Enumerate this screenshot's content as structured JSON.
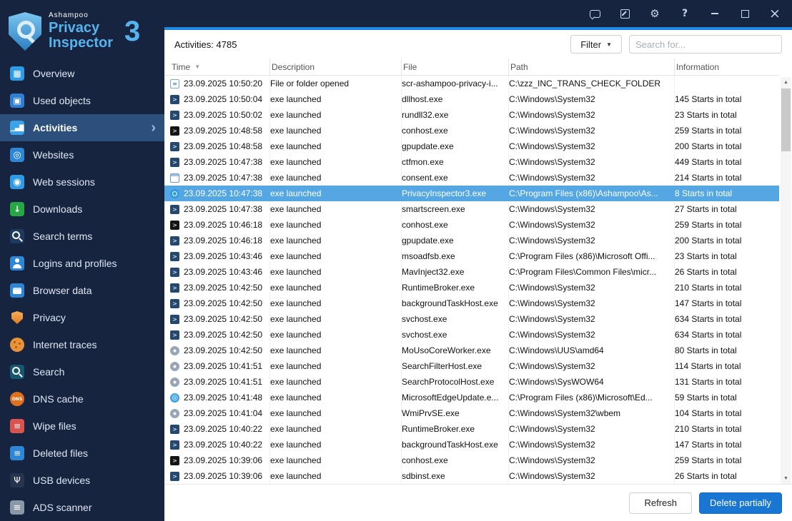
{
  "titlebar": {
    "icons": [
      "feedback-icon",
      "edit-note-icon",
      "settings-icon",
      "help-icon",
      "minimize-icon",
      "maximize-icon",
      "close-icon"
    ]
  },
  "logo": {
    "brand": "Ashampoo",
    "product_line1": "Privacy",
    "product_line2": "Inspector",
    "version": "3"
  },
  "sidebar": {
    "items": [
      {
        "label": "Overview",
        "icon": "overview"
      },
      {
        "label": "Used objects",
        "icon": "used-objects"
      },
      {
        "label": "Activities",
        "icon": "activities",
        "active": true
      },
      {
        "label": "Websites",
        "icon": "websites"
      },
      {
        "label": "Web sessions",
        "icon": "web-sessions"
      },
      {
        "label": "Downloads",
        "icon": "downloads"
      },
      {
        "label": "Search terms",
        "icon": "search-terms"
      },
      {
        "label": "Logins and profiles",
        "icon": "logins"
      },
      {
        "label": "Browser data",
        "icon": "browser-data"
      },
      {
        "label": "Privacy",
        "icon": "privacy"
      },
      {
        "label": "Internet traces",
        "icon": "internet-traces"
      },
      {
        "label": "Search",
        "icon": "search"
      },
      {
        "label": "DNS cache",
        "icon": "dns-cache"
      },
      {
        "label": "Wipe files",
        "icon": "wipe-files"
      },
      {
        "label": "Deleted files",
        "icon": "deleted-files"
      },
      {
        "label": "USB devices",
        "icon": "usb-devices"
      },
      {
        "label": "ADS scanner",
        "icon": "ads-scanner"
      }
    ]
  },
  "toolbar": {
    "count_label": "Activities: 4785",
    "filter_label": "Filter",
    "search_placeholder": "Search for..."
  },
  "table": {
    "columns": [
      "Time",
      "Description",
      "File",
      "Path",
      "Information"
    ],
    "sort_column": "Time",
    "sort_direction": "desc",
    "rows": [
      {
        "icon": "doc",
        "time": "23.09.2025 10:50:20",
        "description": "File or folder opened",
        "file": "scr-ashampoo-privacy-i...",
        "path": "C:\\zzz_INC_TRANS_CHECK_FOLDER",
        "info": ""
      },
      {
        "icon": "console",
        "time": "23.09.2025 10:50:04",
        "description": "exe launched",
        "file": "dllhost.exe",
        "path": "C:\\Windows\\System32",
        "info": "145 Starts in total"
      },
      {
        "icon": "console",
        "time": "23.09.2025 10:50:02",
        "description": "exe launched",
        "file": "rundll32.exe",
        "path": "C:\\Windows\\System32",
        "info": "23 Starts in total"
      },
      {
        "icon": "console-dark",
        "time": "23.09.2025 10:48:58",
        "description": "exe launched",
        "file": "conhost.exe",
        "path": "C:\\Windows\\System32",
        "info": "259 Starts in total"
      },
      {
        "icon": "console",
        "time": "23.09.2025 10:48:58",
        "description": "exe launched",
        "file": "gpupdate.exe",
        "path": "C:\\Windows\\System32",
        "info": "200 Starts in total"
      },
      {
        "icon": "console",
        "time": "23.09.2025 10:47:38",
        "description": "exe launched",
        "file": "ctfmon.exe",
        "path": "C:\\Windows\\System32",
        "info": "449 Starts in total"
      },
      {
        "icon": "window",
        "time": "23.09.2025 10:47:38",
        "description": "exe launched",
        "file": "consent.exe",
        "path": "C:\\Windows\\System32",
        "info": "214 Starts in total"
      },
      {
        "icon": "shield",
        "time": "23.09.2025 10:47:38",
        "description": "exe launched",
        "file": "PrivacyInspector3.exe",
        "path": "C:\\Program Files (x86)\\Ashampoo\\As...",
        "info": "8 Starts in total",
        "selected": true
      },
      {
        "icon": "console",
        "time": "23.09.2025 10:47:38",
        "description": "exe launched",
        "file": "smartscreen.exe",
        "path": "C:\\Windows\\System32",
        "info": "27 Starts in total"
      },
      {
        "icon": "console-dark",
        "time": "23.09.2025 10:46:18",
        "description": "exe launched",
        "file": "conhost.exe",
        "path": "C:\\Windows\\System32",
        "info": "259 Starts in total"
      },
      {
        "icon": "console",
        "time": "23.09.2025 10:46:18",
        "description": "exe launched",
        "file": "gpupdate.exe",
        "path": "C:\\Windows\\System32",
        "info": "200 Starts in total"
      },
      {
        "icon": "console",
        "time": "23.09.2025 10:43:46",
        "description": "exe launched",
        "file": "msoadfsb.exe",
        "path": "C:\\Program Files (x86)\\Microsoft Offi...",
        "info": "23 Starts in total"
      },
      {
        "icon": "console",
        "time": "23.09.2025 10:43:46",
        "description": "exe launched",
        "file": "MavInject32.exe",
        "path": "C:\\Program Files\\Common Files\\micr...",
        "info": "26 Starts in total"
      },
      {
        "icon": "console",
        "time": "23.09.2025 10:42:50",
        "description": "exe launched",
        "file": "RuntimeBroker.exe",
        "path": "C:\\Windows\\System32",
        "info": "210 Starts in total"
      },
      {
        "icon": "console",
        "time": "23.09.2025 10:42:50",
        "description": "exe launched",
        "file": "backgroundTaskHost.exe",
        "path": "C:\\Windows\\System32",
        "info": "147 Starts in total"
      },
      {
        "icon": "console",
        "time": "23.09.2025 10:42:50",
        "description": "exe launched",
        "file": "svchost.exe",
        "path": "C:\\Windows\\System32",
        "info": "634 Starts in total"
      },
      {
        "icon": "console",
        "time": "23.09.2025 10:42:50",
        "description": "exe launched",
        "file": "svchost.exe",
        "path": "C:\\Windows\\System32",
        "info": "634 Starts in total"
      },
      {
        "icon": "gear",
        "time": "23.09.2025 10:42:50",
        "description": "exe launched",
        "file": "MoUsoCoreWorker.exe",
        "path": "C:\\Windows\\UUS\\amd64",
        "info": "80 Starts in total"
      },
      {
        "icon": "gear",
        "time": "23.09.2025 10:41:51",
        "description": "exe launched",
        "file": "SearchFilterHost.exe",
        "path": "C:\\Windows\\System32",
        "info": "114 Starts in total"
      },
      {
        "icon": "gear",
        "time": "23.09.2025 10:41:51",
        "description": "exe launched",
        "file": "SearchProtocolHost.exe",
        "path": "C:\\Windows\\SysWOW64",
        "info": "131 Starts in total"
      },
      {
        "icon": "globe",
        "time": "23.09.2025 10:41:48",
        "description": "exe launched",
        "file": "MicrosoftEdgeUpdate.e...",
        "path": "C:\\Program Files (x86)\\Microsoft\\Ed...",
        "info": "59 Starts in total"
      },
      {
        "icon": "gear",
        "time": "23.09.2025 10:41:04",
        "description": "exe launched",
        "file": "WmiPrvSE.exe",
        "path": "C:\\Windows\\System32\\wbem",
        "info": "104 Starts in total"
      },
      {
        "icon": "console",
        "time": "23.09.2025 10:40:22",
        "description": "exe launched",
        "file": "RuntimeBroker.exe",
        "path": "C:\\Windows\\System32",
        "info": "210 Starts in total"
      },
      {
        "icon": "console",
        "time": "23.09.2025 10:40:22",
        "description": "exe launched",
        "file": "backgroundTaskHost.exe",
        "path": "C:\\Windows\\System32",
        "info": "147 Starts in total"
      },
      {
        "icon": "console-dark",
        "time": "23.09.2025 10:39:06",
        "description": "exe launched",
        "file": "conhost.exe",
        "path": "C:\\Windows\\System32",
        "info": "259 Starts in total"
      },
      {
        "icon": "console",
        "time": "23.09.2025 10:39:06",
        "description": "exe launched",
        "file": "sdbinst.exe",
        "path": "C:\\Windows\\System32",
        "info": "26 Starts in total"
      }
    ]
  },
  "footer": {
    "refresh_label": "Refresh",
    "delete_label": "Delete partially"
  },
  "colors": {
    "accent": "#1e88e5",
    "sidebar_bg": "#172440",
    "selected_row": "#55a7e3",
    "primary_button": "#1976d2"
  }
}
